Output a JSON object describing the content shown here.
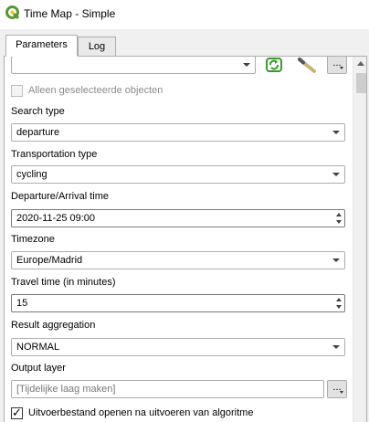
{
  "window": {
    "title": "Time Map - Simple"
  },
  "tabs": [
    {
      "label": "Parameters"
    },
    {
      "label": "Log"
    }
  ],
  "top_row": {
    "value": "",
    "button_label": "..."
  },
  "selected_only": {
    "label": "Alleen geselecteerde objecten",
    "checked": false,
    "enabled": false
  },
  "search_type": {
    "label": "Search type",
    "value": "departure"
  },
  "transportation_type": {
    "label": "Transportation type",
    "value": "cycling"
  },
  "departure_time": {
    "label": "Departure/Arrival time",
    "value": "2020-11-25 09:00"
  },
  "timezone": {
    "label": "Timezone",
    "value": "Europe/Madrid"
  },
  "travel_time": {
    "label": "Travel time (in minutes)",
    "value": "15"
  },
  "result_aggregation": {
    "label": "Result aggregation",
    "value": "NORMAL"
  },
  "output_layer": {
    "label": "Output layer",
    "placeholder": "[Tijdelijke laag maken]",
    "button_label": "..."
  },
  "open_output": {
    "label": "Uitvoerbestand openen na uitvoeren van algoritme",
    "checked": true
  },
  "icons": {
    "app": "qgis-logo-icon",
    "refresh": "refresh-icon",
    "wand": "magic-wand-icon"
  },
  "colors": {
    "qgis_green": "#589632",
    "refresh_green": "#3a9a2b"
  }
}
